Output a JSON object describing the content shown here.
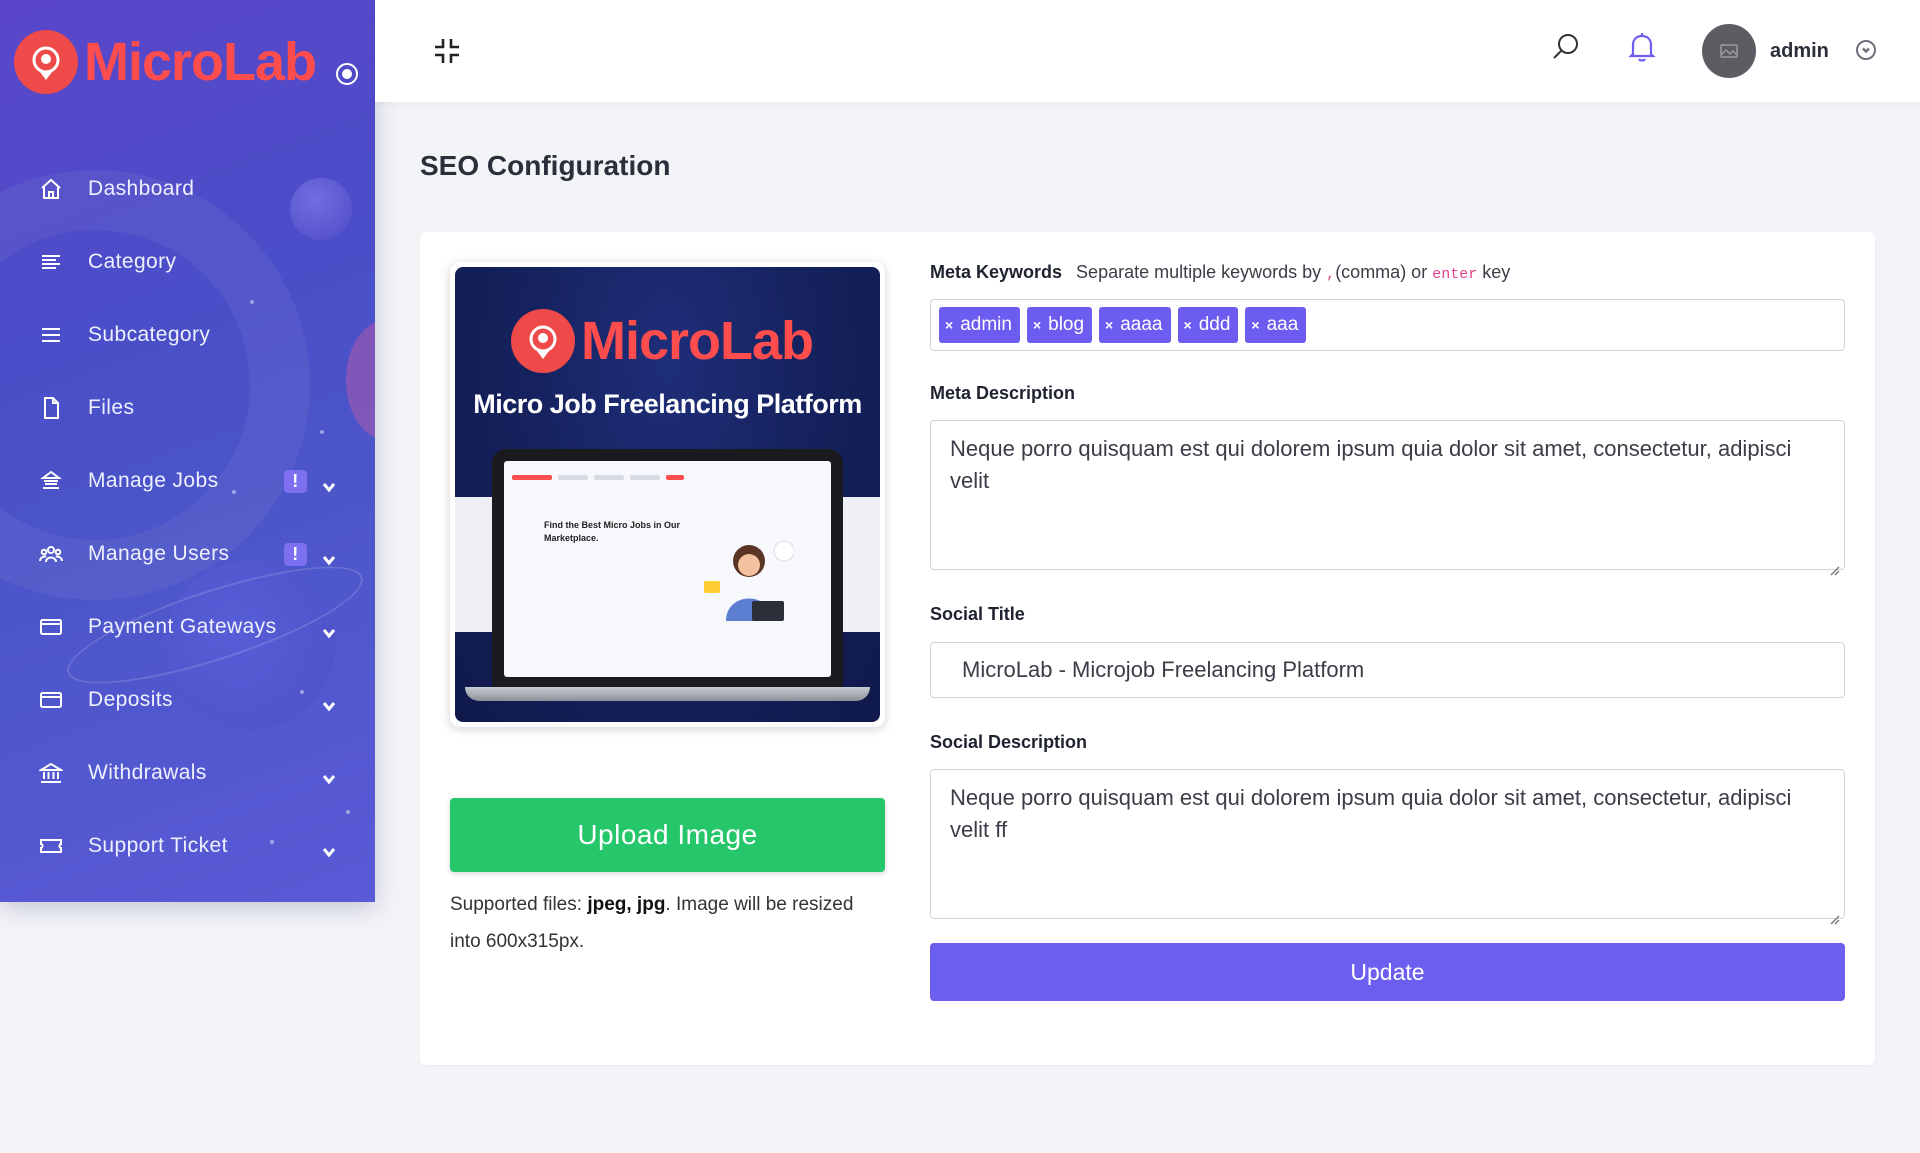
{
  "brand": {
    "name": "MicroLab"
  },
  "sidebar": {
    "items": [
      {
        "label": "Dashboard",
        "icon": "home-icon"
      },
      {
        "label": "Category",
        "icon": "list-icon"
      },
      {
        "label": "Subcategory",
        "icon": "menu-icon"
      },
      {
        "label": "Files",
        "icon": "file-icon"
      },
      {
        "label": "Manage Jobs",
        "icon": "jobs-icon",
        "badge": "!",
        "expandable": true
      },
      {
        "label": "Manage Users",
        "icon": "users-icon",
        "badge": "!",
        "expandable": true
      },
      {
        "label": "Payment Gateways",
        "icon": "card-icon",
        "expandable": true
      },
      {
        "label": "Deposits",
        "icon": "card-icon",
        "expandable": true
      },
      {
        "label": "Withdrawals",
        "icon": "bank-icon",
        "expandable": true
      },
      {
        "label": "Support Ticket",
        "icon": "ticket-icon",
        "expandable": true
      }
    ]
  },
  "topbar": {
    "user_name": "admin"
  },
  "page": {
    "title": "SEO Configuration"
  },
  "preview": {
    "brand": "MicroLab",
    "tagline": "Micro Job Freelancing Platform",
    "screen_heading": "Find the Best Micro Jobs in Our Marketplace."
  },
  "upload": {
    "button_label": "Upload Image",
    "note_prefix": "Supported files: ",
    "note_types": "jpeg, jpg",
    "note_suffix": ". Image will be resized into 600x315px."
  },
  "form": {
    "meta_keywords": {
      "label": "Meta Keywords",
      "hint_prefix": "Separate multiple keywords by ",
      "hint_comma_code": ",",
      "hint_middle": "(comma) or ",
      "hint_enter_code": "enter",
      "hint_suffix": " key",
      "tags": [
        "admin",
        "blog",
        "aaaa",
        "ddd",
        "aaa"
      ],
      "tag_remove": "×"
    },
    "meta_description": {
      "label": "Meta Description",
      "value": "Neque porro quisquam est qui dolorem ipsum quia dolor sit amet, consectetur, adipisci velit"
    },
    "social_title": {
      "label": "Social Title",
      "value": "MicroLab - Microjob Freelancing Platform"
    },
    "social_description": {
      "label": "Social Description",
      "value": "Neque porro quisquam est qui dolorem ipsum quia dolor sit amet, consectetur, adipisci velit ff"
    },
    "submit_label": "Update"
  },
  "colors": {
    "sidebar": "#4a4ec8",
    "brand_red": "#ff4d4d",
    "accent": "#6c5eee",
    "success": "#26c66b",
    "background": "#f3f4f8"
  }
}
